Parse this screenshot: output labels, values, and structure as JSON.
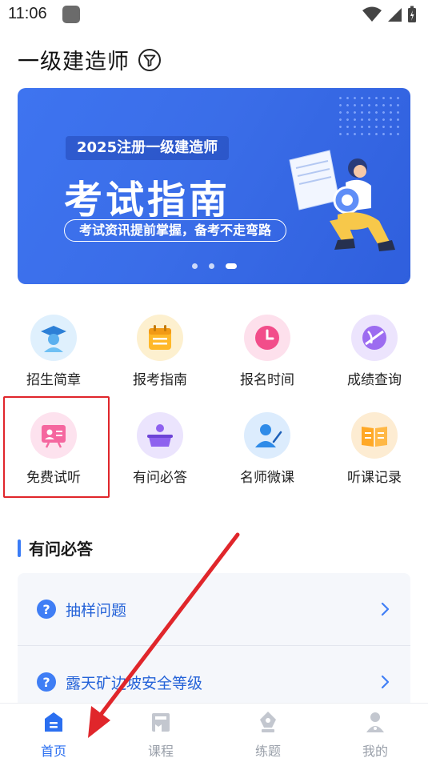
{
  "status_bar": {
    "time": "11:06"
  },
  "header": {
    "title": "一级建造师"
  },
  "banner": {
    "pill": "2025注册一级建造师",
    "headline": "考试指南",
    "subline": "考试资讯提前掌握，备考不走弯路",
    "slide_count": 3,
    "active_slide": 3
  },
  "grid": {
    "items": [
      {
        "label": "招生简章",
        "icon": "graduate-icon",
        "color": "#7dc4f5"
      },
      {
        "label": "报考指南",
        "icon": "calendar-icon",
        "color": "#ffc640"
      },
      {
        "label": "报名时间",
        "icon": "clock-icon",
        "color": "#f4649a"
      },
      {
        "label": "成绩查询",
        "icon": "ball-icon",
        "color": "#a37cf3"
      },
      {
        "label": "免费试听",
        "icon": "presentation-icon",
        "color": "#f46fa4"
      },
      {
        "label": "有问必答",
        "icon": "question-stand-icon",
        "color": "#9c7bf1"
      },
      {
        "label": "名师微课",
        "icon": "teacher-icon",
        "color": "#3d9af0"
      },
      {
        "label": "听课记录",
        "icon": "book-icon",
        "color": "#ffb13f"
      }
    ]
  },
  "faq": {
    "title": "有问必答",
    "items": [
      {
        "text": "抽样问题"
      },
      {
        "text": "露天矿边坡安全等级"
      }
    ]
  },
  "bottom_nav": {
    "items": [
      {
        "label": "首页",
        "active": true
      },
      {
        "label": "课程",
        "active": false
      },
      {
        "label": "练题",
        "active": false
      },
      {
        "label": "我的",
        "active": false
      }
    ]
  },
  "colors": {
    "accent": "#2b6ff0",
    "highlight": "#e0262b"
  }
}
